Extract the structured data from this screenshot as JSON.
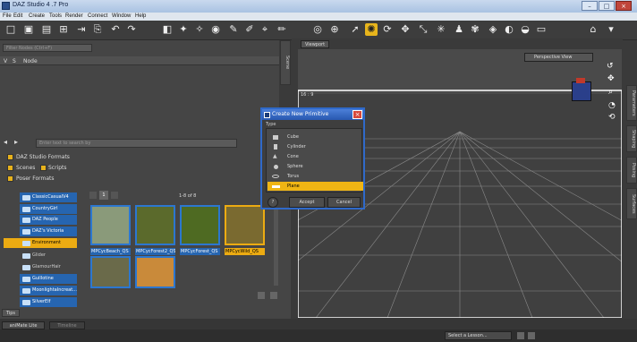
{
  "window": {
    "title": "DAZ Studio 4 .7 Pro",
    "minimize": "–",
    "maximize": "□",
    "close": "×"
  },
  "menu": [
    "File",
    "Edit",
    "Create",
    "Tools",
    "Render",
    "Connect",
    "Window",
    "Help"
  ],
  "scene_pane": {
    "search_placeholder": "Filter Nodes (Ctrl+F)",
    "col_v": "V",
    "col_s": "S",
    "col_node": "Node",
    "tab": "Scene"
  },
  "content_pane": {
    "search_placeholder": "Enter text to search by",
    "filters": {
      "daz_formats": "DAZ Studio Formats",
      "scenes": "Scenes",
      "scripts": "Scripts",
      "poser_formats": "Poser Formats"
    },
    "pager": "1-8 of 8",
    "tree": [
      {
        "label": "ClassicCasualV4",
        "style": "blue"
      },
      {
        "label": "CountryGirl",
        "style": "blue"
      },
      {
        "label": "DAZ People",
        "style": "blue"
      },
      {
        "label": "DAZ's Victoria",
        "style": "blue"
      },
      {
        "label": "Environment",
        "style": "gold"
      },
      {
        "label": "Glider",
        "style": "none"
      },
      {
        "label": "GlamourHair",
        "style": "none"
      },
      {
        "label": "Guillotine",
        "style": "blue"
      },
      {
        "label": "MoonlightaIncreat...",
        "style": "blue"
      },
      {
        "label": "SilverElf",
        "style": "blue"
      }
    ],
    "thumbs": [
      {
        "label": "MPCycBeach_QS",
        "color": "#8a9a7a"
      },
      {
        "label": "MPCycForest2_QS",
        "color": "#5b6a2c"
      },
      {
        "label": "MPCycForest_QS",
        "color": "#4e6a22"
      },
      {
        "label": "MPCycWild_QS",
        "color": "#7a6a30"
      },
      {
        "label": "",
        "color": "#6a6a4a"
      },
      {
        "label": "",
        "color": "#c98a3a"
      }
    ],
    "tab_tips": "Tips"
  },
  "viewport": {
    "tab": "Viewport",
    "view_select": "Perspective View",
    "aspect": "16 : 9"
  },
  "dialog": {
    "title": "Create New Primitive",
    "type_label": "Type",
    "options": [
      "Cube",
      "Cylinder",
      "Cone",
      "Sphere",
      "Torus",
      "Plane"
    ],
    "selected": "Plane",
    "accept": "Accept",
    "cancel": "Cancel",
    "help": "?"
  },
  "right_tabs": [
    "Parameters",
    "Shaping",
    "Posing",
    "Surfaces"
  ],
  "bottom": {
    "tab1": "aniMate Lite",
    "tab2": "Timeline",
    "lesson": "Select a Lesson..."
  },
  "colors": {
    "accent": "#e8b51c",
    "selection_blue": "#2665b0",
    "dialog_border": "#2f69c9"
  }
}
